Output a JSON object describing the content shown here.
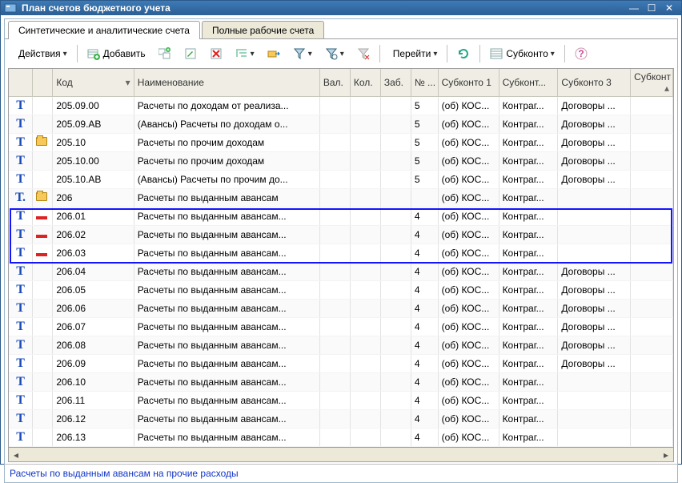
{
  "window": {
    "title": "План счетов бюджетного учета"
  },
  "tabs": [
    {
      "label": "Синтетические и аналитические счета",
      "active": true
    },
    {
      "label": "Полные рабочие счета",
      "active": false
    }
  ],
  "toolbar": {
    "actions": "Действия",
    "add": "Добавить",
    "goto": "Перейти",
    "subkonto": "Субконто"
  },
  "columns": {
    "code": "Код",
    "name": "Наименование",
    "val": "Вал.",
    "kol": "Кол.",
    "zab": "Заб.",
    "no": "№ ...",
    "sub1": "Субконто 1",
    "sub2": "Субконт...",
    "sub3": "Субконто 3",
    "sub4": "Субконт"
  },
  "rows": [
    {
      "t": "Т",
      "icon": "",
      "code": "205.09.00",
      "name": "Расчеты по доходам от реализа...",
      "no": "5",
      "s1": "(об) КОС...",
      "s2": "Контраг...",
      "s3": "Договоры ...",
      "sel": false
    },
    {
      "t": "Т",
      "icon": "",
      "code": "205.09.АВ",
      "name": "(Авансы) Расчеты по доходам о...",
      "no": "5",
      "s1": "(об) КОС...",
      "s2": "Контраг...",
      "s3": "Договоры ...",
      "sel": false
    },
    {
      "t": "Т",
      "icon": "folder",
      "code": "205.10",
      "name": "Расчеты по прочим доходам",
      "no": "5",
      "s1": "(об) КОС...",
      "s2": "Контраг...",
      "s3": "Договоры ...",
      "sel": false
    },
    {
      "t": "Т",
      "icon": "",
      "code": "205.10.00",
      "name": "Расчеты по прочим доходам",
      "no": "5",
      "s1": "(об) КОС...",
      "s2": "Контраг...",
      "s3": "Договоры ...",
      "sel": false
    },
    {
      "t": "Т",
      "icon": "",
      "code": "205.10.АВ",
      "name": "(Авансы) Расчеты по прочим до...",
      "no": "5",
      "s1": "(об) КОС...",
      "s2": "Контраг...",
      "s3": "Договоры ...",
      "sel": false
    },
    {
      "t": "Т.",
      "icon": "folder",
      "code": "206",
      "name": "Расчеты по выданным авансам",
      "no": "",
      "s1": "(об) КОС...",
      "s2": "Контраг...",
      "s3": "",
      "sel": false
    },
    {
      "t": "Т",
      "icon": "minus",
      "code": "206.01",
      "name": "Расчеты по выданным авансам...",
      "no": "4",
      "s1": "(об) КОС...",
      "s2": "Контраг...",
      "s3": "",
      "sel": true
    },
    {
      "t": "Т",
      "icon": "minus",
      "code": "206.02",
      "name": "Расчеты по выданным авансам...",
      "no": "4",
      "s1": "(об) КОС...",
      "s2": "Контраг...",
      "s3": "",
      "sel": true
    },
    {
      "t": "Т",
      "icon": "minus",
      "code": "206.03",
      "name": "Расчеты по выданным авансам...",
      "no": "4",
      "s1": "(об) КОС...",
      "s2": "Контраг...",
      "s3": "",
      "sel": true
    },
    {
      "t": "Т",
      "icon": "",
      "code": "206.04",
      "name": "Расчеты по выданным авансам...",
      "no": "4",
      "s1": "(об) КОС...",
      "s2": "Контраг...",
      "s3": "Договоры ...",
      "sel": false
    },
    {
      "t": "Т",
      "icon": "",
      "code": "206.05",
      "name": "Расчеты по выданным авансам...",
      "no": "4",
      "s1": "(об) КОС...",
      "s2": "Контраг...",
      "s3": "Договоры ...",
      "sel": false
    },
    {
      "t": "Т",
      "icon": "",
      "code": "206.06",
      "name": "Расчеты по выданным авансам...",
      "no": "4",
      "s1": "(об) КОС...",
      "s2": "Контраг...",
      "s3": "Договоры ...",
      "sel": false
    },
    {
      "t": "Т",
      "icon": "",
      "code": "206.07",
      "name": "Расчеты по выданным авансам...",
      "no": "4",
      "s1": "(об) КОС...",
      "s2": "Контраг...",
      "s3": "Договоры ...",
      "sel": false
    },
    {
      "t": "Т",
      "icon": "",
      "code": "206.08",
      "name": "Расчеты по выданным авансам...",
      "no": "4",
      "s1": "(об) КОС...",
      "s2": "Контраг...",
      "s3": "Договоры ...",
      "sel": false
    },
    {
      "t": "Т",
      "icon": "",
      "code": "206.09",
      "name": "Расчеты по выданным авансам...",
      "no": "4",
      "s1": "(об) КОС...",
      "s2": "Контраг...",
      "s3": "Договоры ...",
      "sel": false
    },
    {
      "t": "Т",
      "icon": "",
      "code": "206.10",
      "name": "Расчеты по выданным авансам...",
      "no": "4",
      "s1": "(об) КОС...",
      "s2": "Контраг...",
      "s3": "",
      "sel": false
    },
    {
      "t": "Т",
      "icon": "",
      "code": "206.11",
      "name": "Расчеты по выданным авансам...",
      "no": "4",
      "s1": "(об) КОС...",
      "s2": "Контраг...",
      "s3": "",
      "sel": false
    },
    {
      "t": "Т",
      "icon": "",
      "code": "206.12",
      "name": "Расчеты по выданным авансам...",
      "no": "4",
      "s1": "(об) КОС...",
      "s2": "Контраг...",
      "s3": "",
      "sel": false
    },
    {
      "t": "Т",
      "icon": "",
      "code": "206.13",
      "name": "Расчеты по выданным авансам...",
      "no": "4",
      "s1": "(об) КОС...",
      "s2": "Контраг...",
      "s3": "",
      "sel": false
    }
  ],
  "status": "Расчеты по выданным авансам на прочие расходы"
}
